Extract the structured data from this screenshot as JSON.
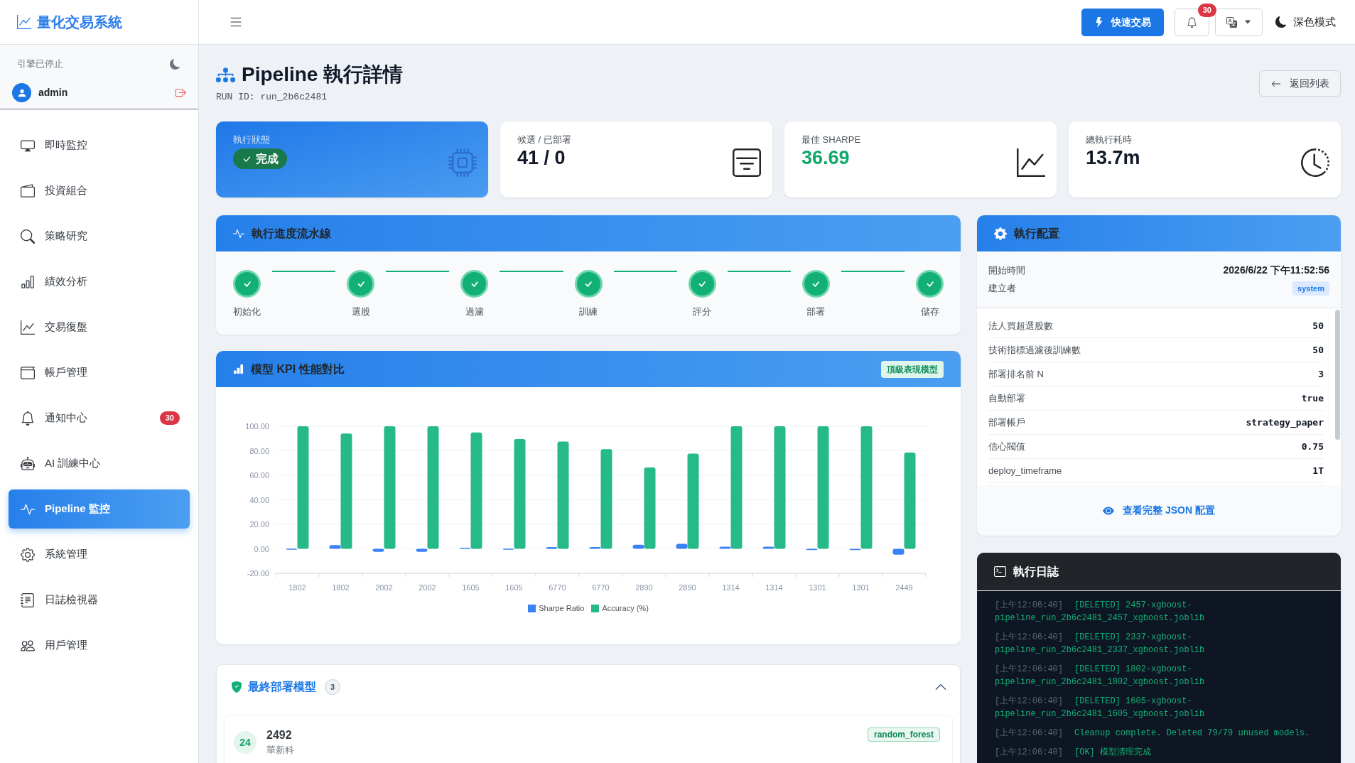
{
  "sidebar": {
    "brand": "量化交易系統",
    "engine_status": "引擎已停止",
    "user": "admin",
    "items": [
      {
        "label": "即時監控",
        "selected": false
      },
      {
        "label": "投資組合",
        "selected": false
      },
      {
        "label": "策略研究",
        "selected": false
      },
      {
        "label": "績效分析",
        "selected": false
      },
      {
        "label": "交易復盤",
        "selected": false
      },
      {
        "label": "帳戶管理",
        "selected": false
      },
      {
        "label": "通知中心",
        "selected": false,
        "badge": "30"
      },
      {
        "label": "AI 訓練中心",
        "selected": false
      },
      {
        "label": "Pipeline 監控",
        "selected": true
      },
      {
        "label": "系統管理",
        "selected": false
      },
      {
        "label": "日誌檢視器",
        "selected": false
      },
      {
        "label": "用戶管理",
        "selected": false
      }
    ]
  },
  "header": {
    "quick_trade": "快速交易",
    "notification_count": "30",
    "theme_toggle": "深色模式"
  },
  "page": {
    "title": "Pipeline 執行詳情",
    "run_id": "RUN ID: run_2b6c2481",
    "back_button": "返回列表"
  },
  "stats": [
    {
      "kind": "status",
      "label": "執行狀態",
      "value": "完成"
    },
    {
      "kind": "count",
      "label": "候選 / 已部署",
      "value": "41 / 0"
    },
    {
      "kind": "sharpe",
      "label": "最佳 SHARPE",
      "value": "36.69"
    },
    {
      "kind": "duration",
      "label": "總執行耗時",
      "value": "13.7m"
    }
  ],
  "pipeline": {
    "title": "執行進度流水線",
    "stages": [
      {
        "label": "初始化",
        "done": true
      },
      {
        "label": "選股",
        "done": true
      },
      {
        "label": "過濾",
        "done": true
      },
      {
        "label": "訓練",
        "done": true
      },
      {
        "label": "評分",
        "done": true
      },
      {
        "label": "部署",
        "done": true
      },
      {
        "label": "儲存",
        "done": true
      }
    ]
  },
  "kpi": {
    "title": "模型 KPI 性能對比",
    "badge": "頂級表現模型",
    "chart_data": {
      "type": "bar",
      "categories": [
        "1802",
        "1802",
        "2002",
        "2002",
        "1605",
        "1605",
        "6770",
        "6770",
        "2890",
        "2890",
        "1314",
        "1314",
        "1301",
        "1301",
        "2449"
      ],
      "series": [
        {
          "name": "Sharpe Ratio",
          "color": "#3b82f6",
          "values": [
            0.1,
            3.0,
            -2.4,
            -2.4,
            0.8,
            0.1,
            1.5,
            1.5,
            3.4,
            4.0,
            1.8,
            1.8,
            -1.0,
            -1.0,
            -4.8
          ]
        },
        {
          "name": "Accuracy (%)",
          "color": "#26b98a",
          "values": [
            100,
            94,
            100,
            100,
            95,
            89.5,
            87.5,
            81.3,
            66.4,
            77.7,
            100,
            100,
            100,
            100,
            78.5
          ]
        }
      ],
      "ylim": [
        -20,
        100
      ],
      "yticks": [
        {
          "value": -20,
          "label": "-20.00"
        },
        {
          "value": 0,
          "label": "0.00"
        },
        {
          "value": 20,
          "label": "20.00"
        },
        {
          "value": 40,
          "label": "40.00"
        },
        {
          "value": 60,
          "label": "60.00"
        },
        {
          "value": 80,
          "label": "80.00"
        },
        {
          "value": 100,
          "label": "100.00"
        }
      ],
      "grid": true,
      "legend": "bottom"
    }
  },
  "final_models": {
    "title": "最終部署模型",
    "count": "3",
    "expanded": true,
    "models": [
      {
        "rank": "24",
        "code": "2492",
        "name": "華新科",
        "type": "random_forest"
      }
    ]
  },
  "config": {
    "title": "執行配置",
    "meta": [
      {
        "kind": "text",
        "label": "開始時間",
        "value": "2026/6/22 下午11:52:56"
      },
      {
        "kind": "tag",
        "label": "建立者",
        "value": "system"
      }
    ],
    "params": [
      {
        "label": "法人買超選股數",
        "value": "50"
      },
      {
        "label": "技術指標過濾後訓練數",
        "value": "50"
      },
      {
        "label": "部署排名前 N",
        "value": "3"
      },
      {
        "label": "自動部署",
        "value": "true"
      },
      {
        "label": "部署帳戶",
        "value": "strategy_paper"
      },
      {
        "label": "信心閥值",
        "value": "0.75"
      },
      {
        "label": "deploy_timeframe",
        "value": "1T"
      }
    ],
    "link": "查看完整 JSON 配置"
  },
  "log": {
    "title": "執行日誌",
    "entries": [
      {
        "time": "[上午12:06:40]",
        "message": "[DELETED] 2457-xgboost-pipeline_run_2b6c2481_2457_xgboost.joblib"
      },
      {
        "time": "[上午12:06:40]",
        "message": "[DELETED] 2337-xgboost-pipeline_run_2b6c2481_2337_xgboost.joblib"
      },
      {
        "time": "[上午12:06:40]",
        "message": "[DELETED] 1802-xgboost-pipeline_run_2b6c2481_1802_xgboost.joblib"
      },
      {
        "time": "[上午12:06:40]",
        "message": "[DELETED] 1605-xgboost-pipeline_run_2b6c2481_1605_xgboost.joblib"
      },
      {
        "time": "[上午12:06:40]",
        "message": "Cleanup complete. Deleted 79/79 unused models."
      },
      {
        "time": "[上午12:06:40]",
        "message": "[OK] 模型清理完成"
      }
    ]
  }
}
